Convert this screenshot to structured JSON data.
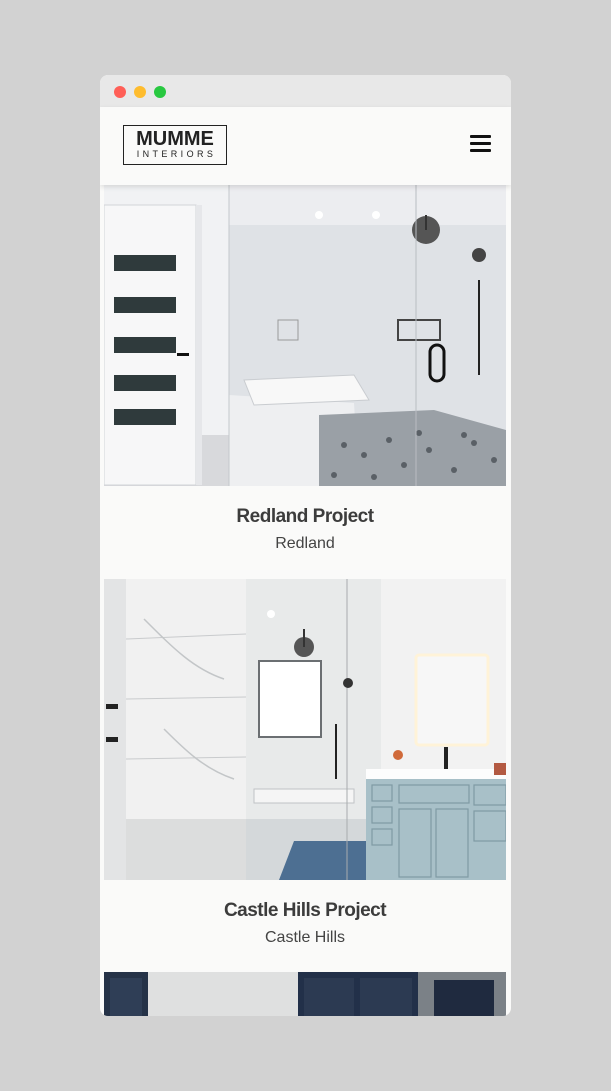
{
  "header": {
    "logo_top": "MUMME",
    "logo_bottom": "INTERIORS",
    "menu_icon": "hamburger-icon"
  },
  "projects": [
    {
      "title": "Redland Project",
      "location": "Redland"
    },
    {
      "title": "Castle Hills Project",
      "location": "Castle Hills"
    }
  ],
  "colors": {
    "background": "#d2d2d2",
    "window": "#fafaf9",
    "text": "#3c3c3c"
  }
}
